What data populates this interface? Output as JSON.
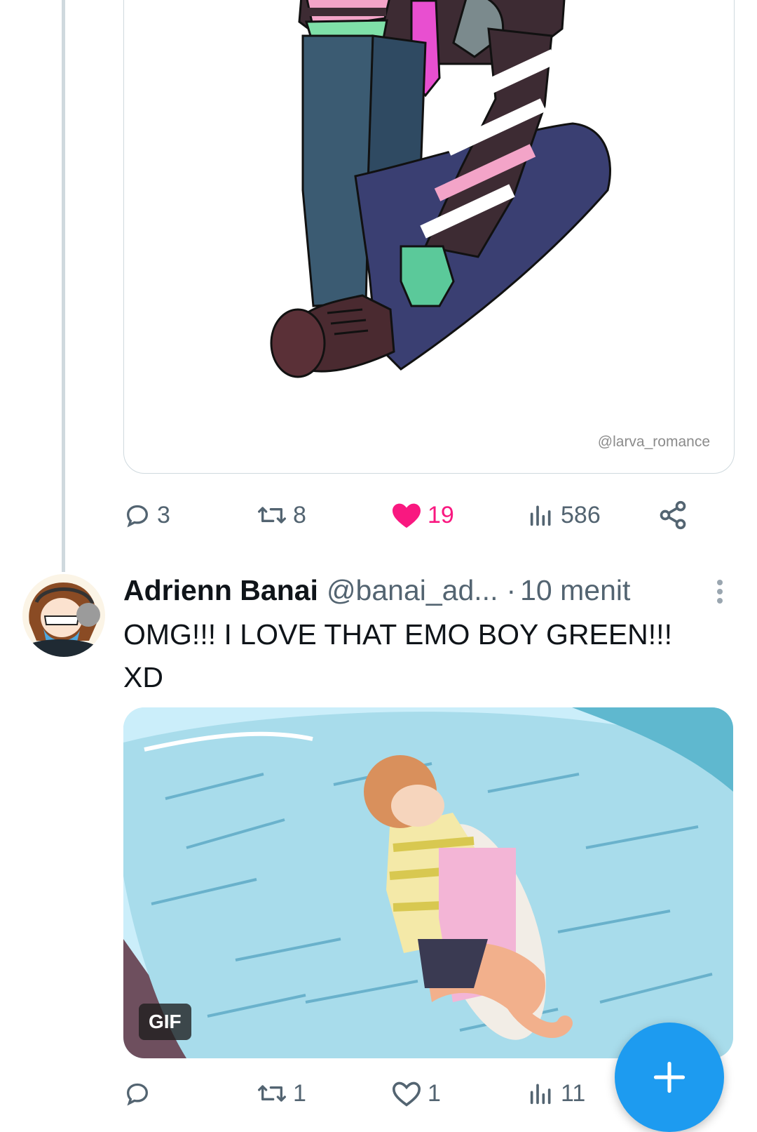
{
  "first_tweet": {
    "media": {
      "watermark": "@larva_romance"
    },
    "actions": {
      "replies": "3",
      "reposts": "8",
      "likes": "19",
      "views": "586",
      "liked": true
    }
  },
  "second_tweet": {
    "author_name": "Adrienn Banai",
    "author_handle": "@banai_ad...",
    "separator": "·",
    "time": "10 menit",
    "text_line1": "OMG!!! I LOVE THAT EMO BOY GREEN!!!",
    "text_line2": "XD",
    "media": {
      "badge": "GIF"
    },
    "actions": {
      "replies": "",
      "reposts": "1",
      "likes": "1",
      "views": "11",
      "liked": false
    }
  },
  "icons": [
    "reply-icon",
    "repost-icon",
    "like-icon",
    "views-icon",
    "share-icon",
    "more-icon",
    "compose-plus-icon"
  ],
  "colors": {
    "accent": "#1d9bf0",
    "like": "#f91880",
    "secondary_text": "#536471",
    "border": "#cfd9de"
  }
}
